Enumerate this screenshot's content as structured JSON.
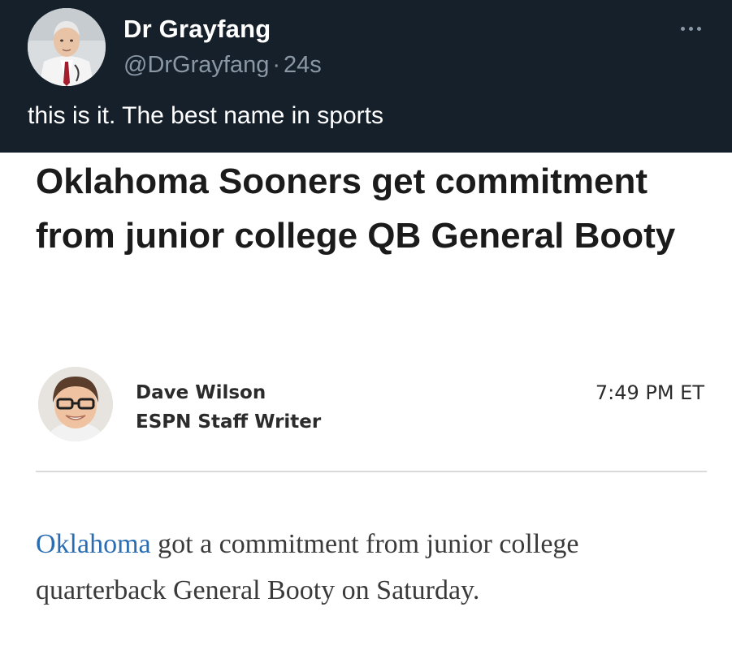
{
  "tweet": {
    "display_name": "Dr Grayfang",
    "handle": "@DrGrayfang",
    "separator": "·",
    "time": "24s",
    "text": "this is it. The best name in sports",
    "more_icon": "more-horizontal-icon",
    "background": "#16202b"
  },
  "article": {
    "headline": "Oklahoma Sooners get commitment from junior college QB General Booty",
    "author": {
      "name": "Dave Wilson",
      "role": "ESPN Staff Writer"
    },
    "time": "7:49 PM ET",
    "body": {
      "link_text": "Oklahoma",
      "rest": " got a commitment from junior college quarterback General Booty on Saturday."
    },
    "link_color": "#2a6db3"
  }
}
